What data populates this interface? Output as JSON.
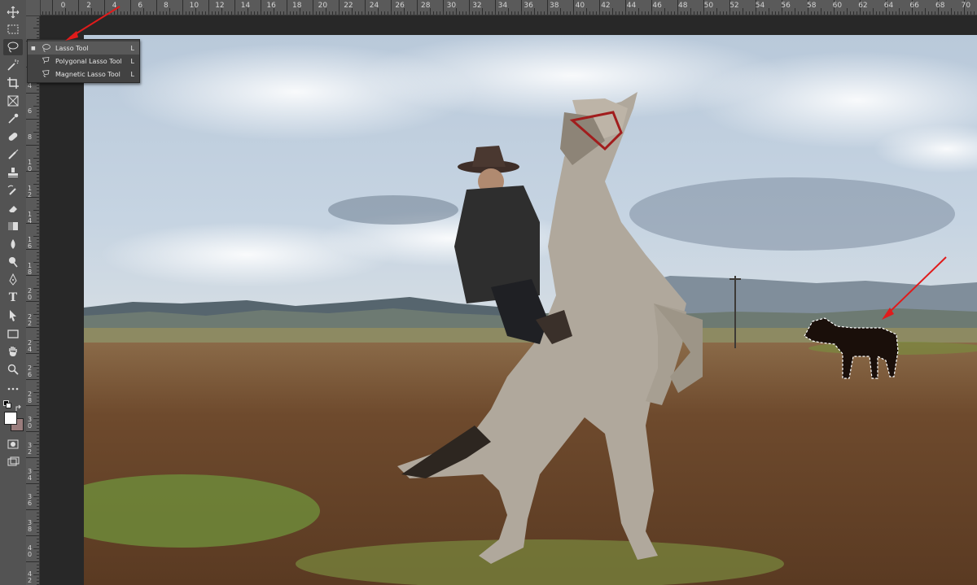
{
  "toolbar": {
    "tools": [
      {
        "name": "move-tool",
        "icon": "move-icon"
      },
      {
        "name": "rectangular-marquee-tool",
        "icon": "marquee-icon"
      },
      {
        "name": "lasso-tool",
        "icon": "lasso-icon",
        "active": true
      },
      {
        "name": "quick-selection-tool",
        "icon": "magic-wand-icon"
      },
      {
        "name": "crop-tool",
        "icon": "crop-icon"
      },
      {
        "name": "frame-tool",
        "icon": "frame-icon"
      },
      {
        "name": "eyedropper-tool",
        "icon": "eyedropper-icon"
      },
      {
        "name": "healing-brush-tool",
        "icon": "bandage-icon"
      },
      {
        "name": "brush-tool",
        "icon": "brush-icon"
      },
      {
        "name": "clone-stamp-tool",
        "icon": "stamp-icon"
      },
      {
        "name": "history-brush-tool",
        "icon": "history-brush-icon"
      },
      {
        "name": "eraser-tool",
        "icon": "eraser-icon"
      },
      {
        "name": "gradient-tool",
        "icon": "gradient-icon"
      },
      {
        "name": "blur-tool",
        "icon": "drop-icon"
      },
      {
        "name": "dodge-tool",
        "icon": "dodge-icon"
      },
      {
        "name": "pen-tool",
        "icon": "pen-icon"
      },
      {
        "name": "type-tool",
        "icon": "type-icon"
      },
      {
        "name": "path-selection-tool",
        "icon": "arrow-icon"
      },
      {
        "name": "rectangle-tool",
        "icon": "rectangle-icon"
      },
      {
        "name": "hand-tool",
        "icon": "hand-icon"
      },
      {
        "name": "zoom-tool",
        "icon": "zoom-icon"
      },
      {
        "name": "edit-toolbar",
        "icon": "more-icon"
      }
    ],
    "foreground_color": "#ffffff",
    "background_color": "#9a7d7d",
    "type_glyph": "T"
  },
  "ruler_top_labels": [
    "2",
    "0",
    "2",
    "4",
    "6",
    "8",
    "10",
    "12",
    "14",
    "16",
    "18",
    "20",
    "22",
    "24",
    "26",
    "28",
    "30",
    "32",
    "34",
    "36",
    "38",
    "40",
    "42",
    "44",
    "46",
    "48",
    "50",
    "52",
    "54",
    "56",
    "58",
    "60",
    "62",
    "64",
    "66",
    "68",
    "70"
  ],
  "ruler_left_labels": [
    "2",
    "4",
    "6",
    "8",
    "10",
    "12",
    "14",
    "16",
    "18",
    "20",
    "22",
    "24",
    "26",
    "28",
    "30",
    "32",
    "34",
    "36",
    "38",
    "40",
    "42",
    "44"
  ],
  "flyout": {
    "items": [
      {
        "label": "Lasso Tool",
        "shortcut": "L",
        "selected": true,
        "icon": "lasso-icon"
      },
      {
        "label": "Polygonal Lasso Tool",
        "shortcut": "L",
        "selected": false,
        "icon": "polygonal-lasso-icon"
      },
      {
        "label": "Magnetic Lasso Tool",
        "shortcut": "L",
        "selected": false,
        "icon": "magnetic-lasso-icon"
      }
    ],
    "selected_marker": "■"
  },
  "colors": {
    "sky": "#c3d1e0",
    "ground": "#6e4a2d",
    "grass": "#6f8a3a",
    "annotation_arrow": "#e01b1b"
  }
}
